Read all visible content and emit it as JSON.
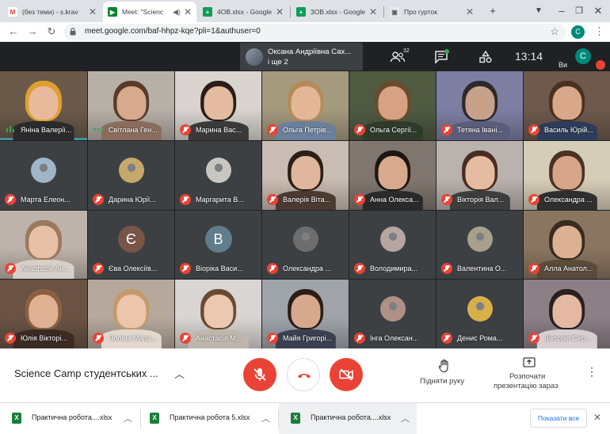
{
  "browser": {
    "tabs": [
      {
        "title": "(без теми) - s.krav",
        "icon": "gmail-icon",
        "icon_glyph": "M",
        "icon_color": "#ea4335",
        "active": false
      },
      {
        "title": "Meet: \"Scienc",
        "icon": "meet-icon",
        "icon_glyph": "▶",
        "icon_color": "#00832d",
        "active": true
      },
      {
        "title": "4OB.xlsx - Google T",
        "icon": "sheets-icon",
        "icon_glyph": "+",
        "icon_color": "#0f9d58",
        "active": false
      },
      {
        "title": "3OB.xlsx - Google T",
        "icon": "sheets-icon",
        "icon_glyph": "+",
        "icon_color": "#0f9d58",
        "active": false
      },
      {
        "title": "Про гурток",
        "icon": "sites-icon",
        "icon_glyph": "▣",
        "icon_color": "#9aa0a6",
        "active": false
      }
    ],
    "new_tab": "+",
    "url": "meet.google.com/baf-hhpz-kqe?pli=1&authuser=0",
    "profile_initial": "C"
  },
  "meet": {
    "speaker_name": "Оксана Андріївна Сах...",
    "speaker_extra": "і ще 2",
    "people_count": "32",
    "clock": "13:14",
    "self_label": "Ви",
    "self_initial": "C",
    "participants": [
      {
        "name": "Яніна Валерії...",
        "status": "speaking",
        "kind": "video",
        "bg": "#6b5a4a",
        "skin": "#e8b99a",
        "hair": "#e0a030",
        "shirt": "#2b2b2b"
      },
      {
        "name": "Світлана Ген...",
        "status": "talking-dots",
        "kind": "video",
        "bg": "#b7b0a7",
        "skin": "#d7a98d",
        "hair": "#5a3b2a",
        "shirt": "#8a6d5c"
      },
      {
        "name": "Марина Вас...",
        "status": "muted",
        "kind": "video",
        "bg": "#d9d4cf",
        "skin": "#e4bba0",
        "hair": "#2a1d17",
        "shirt": "#3a3a3a"
      },
      {
        "name": "Ольга Петрів...",
        "status": "muted",
        "kind": "video",
        "bg": "#a49a7e",
        "skin": "#e3b796",
        "hair": "#b48a57",
        "shirt": "#6b7f9c"
      },
      {
        "name": "Ольга Сергії...",
        "status": "muted",
        "kind": "video",
        "bg": "#4f5a41",
        "skin": "#d6a283",
        "hair": "#6a4a2d",
        "shirt": "#2f3b2a"
      },
      {
        "name": "Тетяна Івані...",
        "status": "muted",
        "kind": "video",
        "bg": "#7c7fa2",
        "skin": "#c7a28b",
        "hair": "#2e2a2a",
        "shirt": "#5a5d7a"
      },
      {
        "name": "Василь Юрій...",
        "status": "muted",
        "kind": "video",
        "bg": "#6e5a4d",
        "skin": "#d9a78a",
        "hair": "#4a3020",
        "shirt": "#2c3c5a"
      },
      {
        "name": "Марта Елеон...",
        "status": "muted",
        "kind": "avatar",
        "bg": "#3c4043",
        "circle": "#9fb6c8"
      },
      {
        "name": "Дарина Юрії...",
        "status": "muted",
        "kind": "avatar",
        "bg": "#3c4043",
        "circle": "#c7a86b"
      },
      {
        "name": "Маргарита В...",
        "status": "muted",
        "kind": "avatar",
        "bg": "#3c4043",
        "circle": "#c9c6c2"
      },
      {
        "name": "Валерія Віта...",
        "status": "muted",
        "kind": "video",
        "bg": "#c9bcb2",
        "skin": "#e0b69c",
        "hair": "#2a1e18",
        "shirt": "#4a3a30"
      },
      {
        "name": "Анна Олекса...",
        "status": "muted",
        "kind": "video",
        "bg": "#7f776f",
        "skin": "#d8a98c",
        "hair": "#1e1612",
        "shirt": "#2a2a2a"
      },
      {
        "name": "Вікторія Вал...",
        "status": "muted",
        "kind": "video",
        "bg": "#b9b2ae",
        "skin": "#e5bca2",
        "hair": "#4a2c22",
        "shirt": "#3d3d3d"
      },
      {
        "name": "Олександра ...",
        "status": "muted",
        "kind": "video",
        "bg": "#d6cdb8",
        "skin": "#d8a58a",
        "hair": "#4a3325",
        "shirt": "#2f2f2f"
      },
      {
        "name": "Анастасія Ан...",
        "status": "muted",
        "kind": "video",
        "bg": "#bdb3aa",
        "skin": "#e7c0a7",
        "hair": "#9a7a5c",
        "shirt": "#d8d0c8"
      },
      {
        "name": "Єва Олексіїв...",
        "status": "muted",
        "kind": "letter",
        "bg": "#3c4043",
        "letter": "Є",
        "circle": "#795548"
      },
      {
        "name": "Віоріка Васи...",
        "status": "muted",
        "kind": "letter",
        "bg": "#3c4043",
        "letter": "В",
        "circle": "#607d8b"
      },
      {
        "name": "Олександра ...",
        "status": "muted",
        "kind": "avatar",
        "bg": "#3c4043",
        "circle": "#6d6d6d"
      },
      {
        "name": "Володимира...",
        "status": "muted",
        "kind": "avatar",
        "bg": "#3c4043",
        "circle": "#b6a6a0"
      },
      {
        "name": "Валентина О...",
        "status": "muted",
        "kind": "avatar",
        "bg": "#3c4043",
        "circle": "#a8a08a"
      },
      {
        "name": "Алла Анатол...",
        "status": "muted",
        "kind": "video",
        "bg": "#8a7560",
        "skin": "#dbb193",
        "hair": "#3a2a20",
        "shirt": "#5a4a3a"
      },
      {
        "name": "Юлія Вікторі...",
        "status": "muted",
        "kind": "video",
        "bg": "#6a5345",
        "skin": "#e0b293",
        "hair": "#8a6040",
        "shirt": "#3a2a22"
      },
      {
        "name": "Поліна Мара...",
        "status": "muted",
        "kind": "video",
        "bg": "#b6a89c",
        "skin": "#ecc6aa",
        "hair": "#c49a6a",
        "shirt": "#e2d8ce"
      },
      {
        "name": "Анастасія М...",
        "status": "muted",
        "kind": "video",
        "bg": "#d9d5d2",
        "skin": "#edc8b0",
        "hair": "#6a4a33",
        "shirt": "#bfb7ae"
      },
      {
        "name": "Майя Григорі...",
        "status": "muted",
        "kind": "video",
        "bg": "#9fa4aa",
        "skin": "#d7a88b",
        "hair": "#2a1d18",
        "shirt": "#3a4050"
      },
      {
        "name": "Інга Олексан...",
        "status": "muted",
        "kind": "avatar",
        "bg": "#3c4043",
        "circle": "#b08f86"
      },
      {
        "name": "Денис Рома...",
        "status": "muted",
        "kind": "avatar",
        "bg": "#3c4043",
        "circle": "#d8b04a"
      },
      {
        "name": "Вікторія Сер...",
        "status": "muted",
        "kind": "video",
        "bg": "#8c7f86",
        "skin": "#e3b9a2",
        "hair": "#2a1f1f",
        "shirt": "#d7cfd2"
      }
    ]
  },
  "controls": {
    "meeting_title": "Science Camp студентських ...",
    "raise_hand_label": "Підняти руку",
    "present_label_line1": "Розпочати",
    "present_label_line2": "презентацію зараз"
  },
  "downloads": {
    "items": [
      {
        "file": "Практична робота....xlsx"
      },
      {
        "file": "Практична робота 5.xlsx"
      },
      {
        "file": "Практична робота....xlsx"
      }
    ],
    "show_all_label": "Показати все"
  }
}
